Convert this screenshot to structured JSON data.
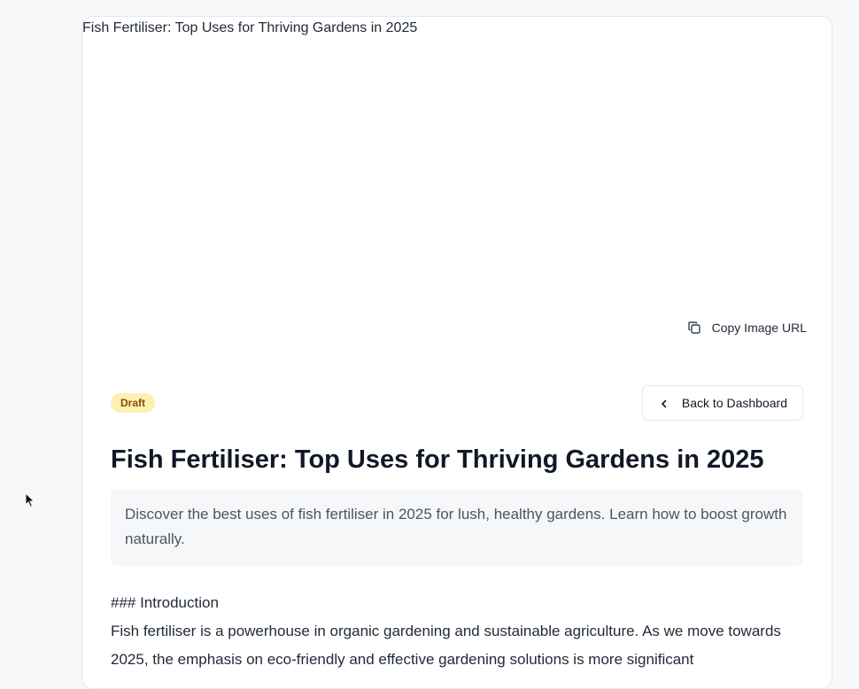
{
  "hero": {
    "alt_text": "Fish Fertiliser: Top Uses for Thriving Gardens in 2025",
    "copy_button_label": "Copy Image URL"
  },
  "post": {
    "status_badge": "Draft",
    "back_button_label": "Back to Dashboard",
    "title": "Fish Fertiliser: Top Uses for Thriving Gardens in 2025",
    "summary": "Discover the best uses of fish fertiliser in 2025 for lush, healthy gardens. Learn how to boost growth naturally.",
    "content_heading": "### Introduction",
    "content_paragraph": "Fish fertiliser is a powerhouse in organic gardening and sustainable agriculture. As we move towards 2025, the emphasis on eco-friendly and effective gardening solutions is more significant"
  },
  "colors": {
    "page_bg": "#f6f8fa",
    "badge_bg": "#fdf0b3",
    "badge_text": "#854d0e",
    "summary_bg": "#f6f7f9"
  },
  "icons": {
    "copy": "copy-icon",
    "back": "chevron-left-icon",
    "cursor": "mouse-pointer-icon"
  }
}
